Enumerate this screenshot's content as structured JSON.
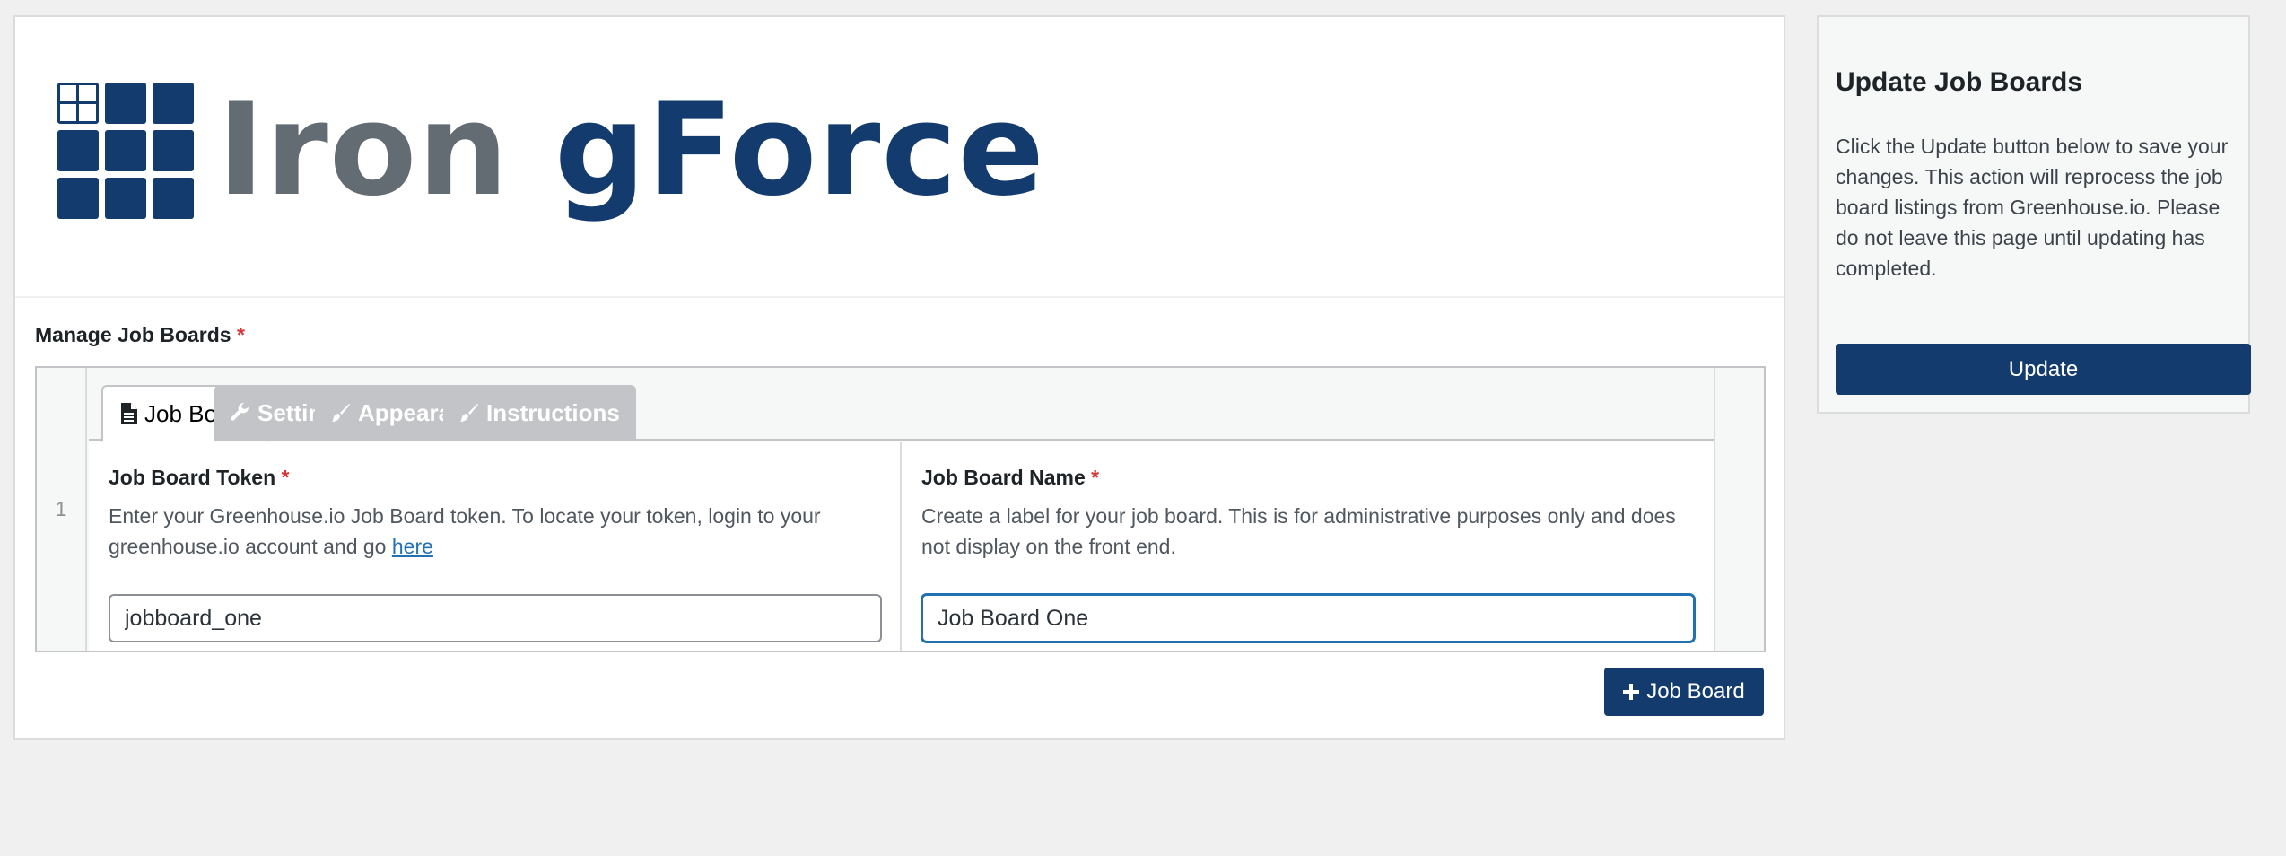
{
  "logo": {
    "part1": "Iron ",
    "part2": "gForce"
  },
  "section": {
    "label": "Manage Job Boards",
    "required": "*"
  },
  "repeater": {
    "row_number": "1",
    "tabs": [
      {
        "label": "Job Board",
        "icon": "document-icon",
        "active": true
      },
      {
        "label": "Settings",
        "icon": "wrench-icon",
        "active": false
      },
      {
        "label": "Appearance",
        "icon": "paintbrush-icon",
        "active": false
      },
      {
        "label": "Instructions",
        "icon": "paintbrush-icon",
        "active": false
      }
    ],
    "token_field": {
      "label": "Job Board Token",
      "required": "*",
      "desc": "Enter your Greenhouse.io Job Board token. To locate your token, login to your greenhouse.io account and go ",
      "link": "here",
      "value": "jobboard_one"
    },
    "name_field": {
      "label": "Job Board Name",
      "required": "*",
      "desc": "Create a label for your job board. This is for administrative purposes only and does not display on the front end.",
      "value": "Job Board One"
    }
  },
  "add_button": {
    "icon": "plus-icon",
    "label": "Job Board"
  },
  "sidebar": {
    "title": "Update Job Boards",
    "text": "Click the Update button below to save your changes. This action will reprocess the job board listings from Greenhouse.io. Please do not leave this page until updating has completed.",
    "button": "Update"
  },
  "colors": {
    "brand": "#143b6e",
    "logo_gray": "#636b73",
    "required": "#d63638",
    "link": "#2271b1"
  }
}
